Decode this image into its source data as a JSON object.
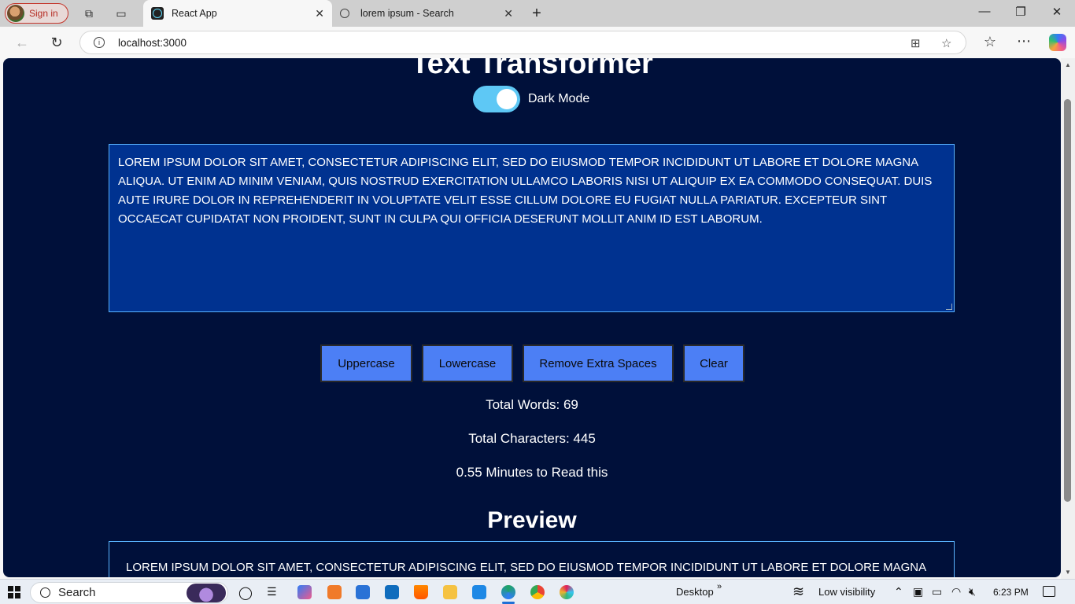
{
  "browser": {
    "signin_label": "Sign in",
    "tabs": [
      {
        "label": "React App",
        "icon": "react-icon",
        "active": true
      },
      {
        "label": "lorem ipsum - Search",
        "icon": "search-icon",
        "active": false
      }
    ],
    "new_tab_label": "+",
    "address": "localhost:3000"
  },
  "app": {
    "title": "Text Transformer",
    "toggle_label": "Dark Mode",
    "dark_mode": true,
    "textarea_value": "LOREM IPSUM DOLOR SIT AMET, CONSECTETUR ADIPISCING ELIT, SED DO EIUSMOD TEMPOR INCIDIDUNT UT LABORE ET DOLORE MAGNA ALIQUA. UT ENIM AD MINIM VENIAM, QUIS NOSTRUD EXERCITATION ULLAMCO LABORIS NISI UT ALIQUIP EX EA COMMODO CONSEQUAT. DUIS AUTE IRURE DOLOR IN REPREHENDERIT IN VOLUPTATE VELIT ESSE CILLUM DOLORE EU FUGIAT NULLA PARIATUR. EXCEPTEUR SINT OCCAECAT CUPIDATAT NON PROIDENT, SUNT IN CULPA QUI OFFICIA DESERUNT MOLLIT ANIM ID EST LABORUM.",
    "buttons": {
      "uppercase": "Uppercase",
      "lowercase": "Lowercase",
      "remove_spaces": "Remove Extra Spaces",
      "clear": "Clear"
    },
    "stats": {
      "words": "Total Words: 69",
      "characters": "Total Characters: 445",
      "read_time": "0.55 Minutes to Read this"
    },
    "preview_title": "Preview",
    "preview_text": "LOREM IPSUM DOLOR SIT AMET, CONSECTETUR ADIPISCING ELIT, SED DO EIUSMOD TEMPOR INCIDIDUNT UT LABORE ET DOLORE MAGNA"
  },
  "taskbar": {
    "search_label": "Search",
    "desktop_label": "Desktop",
    "weather_label": "Low visibility",
    "time": "6:23 PM"
  },
  "colors": {
    "page_bg": "#00103a",
    "textarea_bg": "#003290",
    "button_bg": "#4c7ff5",
    "toggle_on": "#5ec8f5"
  }
}
